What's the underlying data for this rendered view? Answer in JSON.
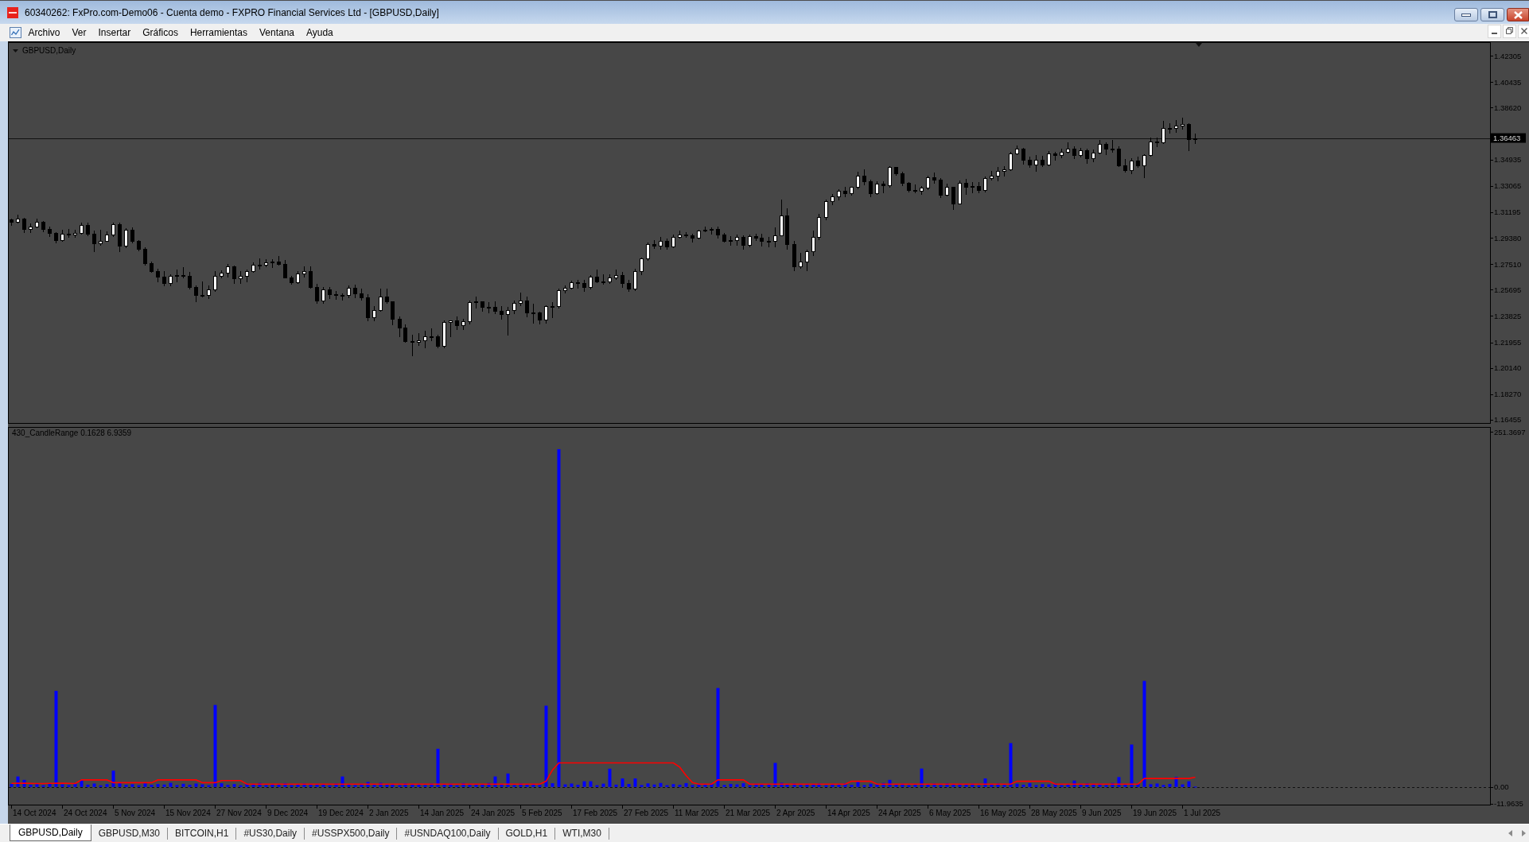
{
  "window": {
    "title": "60340262: FxPro.com-Demo06 - Cuenta demo - FXPRO Financial Services Ltd - [GBPUSD,Daily]"
  },
  "menu": {
    "items": [
      "Archivo",
      "Ver",
      "Insertar",
      "Gráficos",
      "Herramientas",
      "Ventana",
      "Ayuda"
    ]
  },
  "chart_window": {
    "chart_data": [
      {
        "type": "candlestick",
        "title": "GBPUSD,Daily",
        "tick_labels": "y",
        "ylim": [
          1.1617,
          1.4327
        ],
        "yticks": [
          1.42305,
          1.40435,
          {
            "value": 1.3862,
            "label": "1.38620"
          },
          1.34935,
          1.33065,
          1.31195,
          {
            "value": 1.2938,
            "label": "1.29380"
          },
          {
            "value": 1.2751,
            "label": "1.27510"
          },
          1.25695,
          1.23825,
          1.21955,
          {
            "value": 1.2014,
            "label": "1.20140"
          },
          {
            "value": 1.1827,
            "label": "1.18270"
          },
          1.16455
        ],
        "ref_lines": [
          {
            "axis": "y",
            "value": 1.36463,
            "label": "1.36463"
          }
        ],
        "ohlc": [
          [
            1.3067,
            1.3076,
            1.3031,
            1.3053
          ],
          [
            1.3053,
            1.3103,
            1.3048,
            1.3071
          ],
          [
            1.3071,
            1.308,
            1.298,
            1.2999
          ],
          [
            1.2999,
            1.304,
            1.2975,
            1.3017
          ],
          [
            1.3017,
            1.3071,
            1.301,
            1.3049
          ],
          [
            1.3049,
            1.3058,
            1.2985,
            1.2999
          ],
          [
            1.2999,
            1.3018,
            1.2949,
            1.297
          ],
          [
            1.297,
            1.298,
            1.2906,
            1.2922
          ],
          [
            1.2922,
            1.2996,
            1.2915,
            1.2969
          ],
          [
            1.2969,
            1.3002,
            1.2946,
            1.2959
          ],
          [
            1.2959,
            1.2996,
            1.2941,
            1.2973
          ],
          [
            1.2973,
            1.3044,
            1.2967,
            1.3028
          ],
          [
            1.3028,
            1.3044,
            1.2954,
            1.2967
          ],
          [
            1.2967,
            1.2989,
            1.2844,
            1.2897
          ],
          [
            1.2897,
            1.2993,
            1.2887,
            1.2917
          ],
          [
            1.2917,
            1.2984,
            1.2916,
            1.2962
          ],
          [
            1.2962,
            1.3048,
            1.2951,
            1.3036
          ],
          [
            1.3036,
            1.3047,
            1.2844,
            1.2882
          ],
          [
            1.2882,
            1.3008,
            1.287,
            1.2997
          ],
          [
            1.2997,
            1.301,
            1.2906,
            1.2915
          ],
          [
            1.2915,
            1.2922,
            1.285,
            1.2861
          ],
          [
            1.2861,
            1.2868,
            1.2745,
            1.2758
          ],
          [
            1.2758,
            1.277,
            1.2697,
            1.2701
          ],
          [
            1.2701,
            1.272,
            1.263,
            1.2664
          ],
          [
            1.2664,
            1.2702,
            1.2597,
            1.2616
          ],
          [
            1.2616,
            1.2676,
            1.2597,
            1.2667
          ],
          [
            1.2667,
            1.2713,
            1.2629,
            1.2673
          ],
          [
            1.2673,
            1.2728,
            1.2654,
            1.2668
          ],
          [
            1.2668,
            1.2695,
            1.2576,
            1.2588
          ],
          [
            1.2588,
            1.2599,
            1.2487,
            1.253
          ],
          [
            1.253,
            1.2628,
            1.252,
            1.2531
          ],
          [
            1.2531,
            1.2597,
            1.2508,
            1.2572
          ],
          [
            1.2572,
            1.27,
            1.256,
            1.2666
          ],
          [
            1.2666,
            1.2705,
            1.2656,
            1.2688
          ],
          [
            1.2688,
            1.2749,
            1.266,
            1.2735
          ],
          [
            1.2735,
            1.2741,
            1.2616,
            1.265
          ],
          [
            1.265,
            1.27,
            1.2615,
            1.2668
          ],
          [
            1.2668,
            1.2715,
            1.2626,
            1.2701
          ],
          [
            1.2701,
            1.2765,
            1.2695,
            1.2745
          ],
          [
            1.2745,
            1.279,
            1.2716,
            1.2744
          ],
          [
            1.2744,
            1.2787,
            1.2735,
            1.2761
          ],
          [
            1.2761,
            1.2783,
            1.273,
            1.2771
          ],
          [
            1.2771,
            1.2811,
            1.2744,
            1.275
          ],
          [
            1.275,
            1.278,
            1.2654,
            1.2658
          ],
          [
            1.2658,
            1.2669,
            1.2613,
            1.262
          ],
          [
            1.262,
            1.2703,
            1.2618,
            1.2686
          ],
          [
            1.2686,
            1.2733,
            1.2662,
            1.27
          ],
          [
            1.27,
            1.2735,
            1.2585,
            1.2587
          ],
          [
            1.2587,
            1.2609,
            1.2475,
            1.2492
          ],
          [
            1.2492,
            1.2586,
            1.2475,
            1.2571
          ],
          [
            1.2571,
            1.2587,
            1.2509,
            1.2535
          ],
          [
            1.2535,
            1.256,
            1.2503,
            1.253
          ],
          [
            1.253,
            1.2544,
            1.2497,
            1.253
          ],
          [
            1.253,
            1.26,
            1.2516,
            1.258
          ],
          [
            1.258,
            1.2607,
            1.2515,
            1.2545
          ],
          [
            1.2545,
            1.2576,
            1.2498,
            1.2515
          ],
          [
            1.2515,
            1.2537,
            1.2351,
            1.2376
          ],
          [
            1.2376,
            1.2453,
            1.2351,
            1.2422
          ],
          [
            1.2422,
            1.2575,
            1.242,
            1.2519
          ],
          [
            1.2519,
            1.2576,
            1.2474,
            1.2484
          ],
          [
            1.2484,
            1.2487,
            1.232,
            1.2363
          ],
          [
            1.2363,
            1.238,
            1.2239,
            1.2302
          ],
          [
            1.2302,
            1.2322,
            1.22,
            1.2205
          ],
          [
            1.2205,
            1.225,
            1.21,
            1.2201
          ],
          [
            1.2201,
            1.2259,
            1.2175,
            1.2208
          ],
          [
            1.2208,
            1.228,
            1.216,
            1.2239
          ],
          [
            1.2239,
            1.2292,
            1.221,
            1.2237
          ],
          [
            1.2237,
            1.2252,
            1.216,
            1.217
          ],
          [
            1.217,
            1.235,
            1.216,
            1.2342
          ],
          [
            1.2342,
            1.2353,
            1.2236,
            1.2352
          ],
          [
            1.2352,
            1.2378,
            1.229,
            1.2316
          ],
          [
            1.2316,
            1.2365,
            1.229,
            1.2344
          ],
          [
            1.2344,
            1.2493,
            1.2329,
            1.248
          ],
          [
            1.248,
            1.2523,
            1.244,
            1.2484
          ],
          [
            1.2484,
            1.2487,
            1.242,
            1.2446
          ],
          [
            1.2446,
            1.2479,
            1.241,
            1.2448
          ],
          [
            1.2448,
            1.2486,
            1.24,
            1.242
          ],
          [
            1.242,
            1.2451,
            1.2364,
            1.2394
          ],
          [
            1.2394,
            1.2445,
            1.2249,
            1.2422
          ],
          [
            1.2422,
            1.2494,
            1.24,
            1.2476
          ],
          [
            1.2476,
            1.255,
            1.2457,
            1.2494
          ],
          [
            1.2494,
            1.2522,
            1.238,
            1.2409
          ],
          [
            1.2409,
            1.247,
            1.2334,
            1.2405
          ],
          [
            1.2405,
            1.2415,
            1.2331,
            1.2358
          ],
          [
            1.2358,
            1.2457,
            1.2335,
            1.2451
          ],
          [
            1.2451,
            1.2478,
            1.2375,
            1.2454
          ],
          [
            1.2454,
            1.2576,
            1.2439,
            1.2564
          ],
          [
            1.2564,
            1.26,
            1.255,
            1.2582
          ],
          [
            1.2582,
            1.2632,
            1.2578,
            1.262
          ],
          [
            1.262,
            1.264,
            1.2585,
            1.2617
          ],
          [
            1.2617,
            1.264,
            1.256,
            1.259
          ],
          [
            1.259,
            1.2674,
            1.2577,
            1.2664
          ],
          [
            1.2664,
            1.2715,
            1.262,
            1.2629
          ],
          [
            1.2629,
            1.2678,
            1.261,
            1.2627
          ],
          [
            1.2627,
            1.268,
            1.2616,
            1.2657
          ],
          [
            1.2657,
            1.2715,
            1.2647,
            1.2671
          ],
          [
            1.2671,
            1.2693,
            1.259,
            1.2617
          ],
          [
            1.2617,
            1.2637,
            1.256,
            1.2575
          ],
          [
            1.2575,
            1.2718,
            1.2566,
            1.2703
          ],
          [
            1.2703,
            1.2798,
            1.2676,
            1.2794
          ],
          [
            1.2794,
            1.2906,
            1.2778,
            1.2895
          ],
          [
            1.2895,
            1.2921,
            1.2862,
            1.2883
          ],
          [
            1.2883,
            1.2946,
            1.2861,
            1.2918
          ],
          [
            1.2918,
            1.2932,
            1.286,
            1.2878
          ],
          [
            1.2878,
            1.296,
            1.2873,
            1.2944
          ],
          [
            1.2944,
            1.2989,
            1.294,
            1.2963
          ],
          [
            1.2963,
            1.298,
            1.2943,
            1.2953
          ],
          [
            1.2953,
            1.2969,
            1.2908,
            1.2936
          ],
          [
            1.2936,
            1.2997,
            1.293,
            1.2987
          ],
          [
            1.2987,
            1.3015,
            1.2981,
            1.2997
          ],
          [
            1.2997,
            1.3014,
            1.2964,
            1.3
          ],
          [
            1.3,
            1.3015,
            1.294,
            1.2959
          ],
          [
            1.2959,
            1.2971,
            1.291,
            1.2918
          ],
          [
            1.2918,
            1.2951,
            1.2886,
            1.2921
          ],
          [
            1.2921,
            1.296,
            1.289,
            1.2946
          ],
          [
            1.2946,
            1.2957,
            1.2861,
            1.2888
          ],
          [
            1.2888,
            1.296,
            1.2874,
            1.2947
          ],
          [
            1.2947,
            1.2967,
            1.292,
            1.294
          ],
          [
            1.294,
            1.2964,
            1.2879,
            1.2918
          ],
          [
            1.2918,
            1.2943,
            1.2876,
            1.2916
          ],
          [
            1.2916,
            1.301,
            1.2877,
            1.2957
          ],
          [
            1.2957,
            1.3207,
            1.2955,
            1.3097
          ],
          [
            1.3097,
            1.3148,
            1.286,
            1.2895
          ],
          [
            1.2895,
            1.2915,
            1.2708,
            1.2736
          ],
          [
            1.2736,
            1.283,
            1.2725,
            1.2766
          ],
          [
            1.2766,
            1.2855,
            1.2707,
            1.284
          ],
          [
            1.284,
            1.299,
            1.2812,
            1.2941
          ],
          [
            1.2941,
            1.3106,
            1.2926,
            1.3086
          ],
          [
            1.3086,
            1.3208,
            1.307,
            1.3196
          ],
          [
            1.3196,
            1.3251,
            1.3174,
            1.3234
          ],
          [
            1.3234,
            1.3283,
            1.3207,
            1.3269
          ],
          [
            1.3269,
            1.3297,
            1.3233,
            1.3254
          ],
          [
            1.3254,
            1.3302,
            1.3243,
            1.3298
          ],
          [
            1.3298,
            1.3405,
            1.329,
            1.3377
          ],
          [
            1.3377,
            1.3423,
            1.3318,
            1.3341
          ],
          [
            1.3341,
            1.3351,
            1.3233,
            1.3253
          ],
          [
            1.3253,
            1.3337,
            1.325,
            1.3322
          ],
          [
            1.3322,
            1.3341,
            1.3262,
            1.3311
          ],
          [
            1.3311,
            1.3445,
            1.3302,
            1.344
          ],
          [
            1.344,
            1.3443,
            1.3382,
            1.3396
          ],
          [
            1.3396,
            1.3405,
            1.331,
            1.3328
          ],
          [
            1.3328,
            1.3336,
            1.3263,
            1.3279
          ],
          [
            1.3279,
            1.3317,
            1.3259,
            1.3269
          ],
          [
            1.3269,
            1.3304,
            1.325,
            1.3295
          ],
          [
            1.3295,
            1.338,
            1.328,
            1.3366
          ],
          [
            1.3366,
            1.3402,
            1.3326,
            1.335
          ],
          [
            1.335,
            1.3362,
            1.3228,
            1.3245
          ],
          [
            1.3245,
            1.332,
            1.324,
            1.33
          ],
          [
            1.33,
            1.33,
            1.314,
            1.3183
          ],
          [
            1.3183,
            1.3343,
            1.318,
            1.3328
          ],
          [
            1.3328,
            1.3358,
            1.325,
            1.3302
          ],
          [
            1.3302,
            1.3335,
            1.326,
            1.3305
          ],
          [
            1.3305,
            1.3335,
            1.326,
            1.3278
          ],
          [
            1.3278,
            1.3373,
            1.3265,
            1.3359
          ],
          [
            1.3359,
            1.3413,
            1.335,
            1.3378
          ],
          [
            1.3378,
            1.3439,
            1.3345,
            1.3414
          ],
          [
            1.3414,
            1.3444,
            1.338,
            1.3424
          ],
          [
            1.3424,
            1.3546,
            1.3417,
            1.3535
          ],
          [
            1.3535,
            1.3593,
            1.353,
            1.3568
          ],
          [
            1.3568,
            1.3575,
            1.3464,
            1.3491
          ],
          [
            1.3491,
            1.3515,
            1.344,
            1.3459
          ],
          [
            1.3459,
            1.3527,
            1.3415,
            1.3494
          ],
          [
            1.3494,
            1.352,
            1.3446,
            1.3459
          ],
          [
            1.3459,
            1.3555,
            1.345,
            1.3535
          ],
          [
            1.3535,
            1.355,
            1.3492,
            1.3528
          ],
          [
            1.3528,
            1.357,
            1.351,
            1.3549
          ],
          [
            1.3549,
            1.3616,
            1.354,
            1.3571
          ],
          [
            1.3571,
            1.359,
            1.35,
            1.3528
          ],
          [
            1.3528,
            1.3575,
            1.3515,
            1.356
          ],
          [
            1.356,
            1.357,
            1.347,
            1.35
          ],
          [
            1.35,
            1.3564,
            1.348,
            1.3543
          ],
          [
            1.3543,
            1.3632,
            1.3535,
            1.3606
          ],
          [
            1.3606,
            1.3615,
            1.3532,
            1.3571
          ],
          [
            1.3571,
            1.3632,
            1.355,
            1.3572
          ],
          [
            1.3572,
            1.359,
            1.3445,
            1.3451
          ],
          [
            1.3451,
            1.3495,
            1.3405,
            1.3419
          ],
          [
            1.3419,
            1.35,
            1.3395,
            1.3485
          ],
          [
            1.3485,
            1.3515,
            1.344,
            1.345
          ],
          [
            1.345,
            1.353,
            1.337,
            1.3525
          ],
          [
            1.3525,
            1.365,
            1.352,
            1.3619
          ],
          [
            1.3619,
            1.3652,
            1.359,
            1.3615
          ],
          [
            1.3615,
            1.377,
            1.361,
            1.372
          ],
          [
            1.372,
            1.3749,
            1.3685,
            1.3717
          ],
          [
            1.3717,
            1.3771,
            1.369,
            1.3732
          ],
          [
            1.3732,
            1.3788,
            1.371,
            1.3745
          ],
          [
            1.3745,
            1.375,
            1.356,
            1.3639
          ],
          [
            1.3639,
            1.368,
            1.361,
            1.3646
          ],
          null,
          null,
          null,
          null,
          null,
          null,
          null,
          null,
          null,
          null,
          null,
          null,
          null,
          null,
          null,
          null,
          null,
          null,
          null,
          null,
          null,
          null,
          null,
          null,
          null,
          null,
          null,
          null,
          null,
          null,
          null,
          null,
          null,
          null,
          null,
          null,
          null,
          null,
          null,
          null,
          null,
          null,
          null,
          null,
          null,
          null
        ]
      },
      {
        "type": "bar",
        "title": "430_CandleRange 0.1628 6.9359",
        "tick_labels": "y",
        "ylim": [
          -13.09,
          254.75
        ],
        "yticks": [
          251.3697,
          {
            "value": 0,
            "label": "0.00"
          },
          -11.9635
        ],
        "ref_lines": [
          {
            "axis": "y",
            "value": 0,
            "line_style": "dashed"
          }
        ],
        "series": [
          {
            "type": "bar",
            "color": "#0000ff",
            "values": [
              2.1,
              7.4,
              5,
              1.5,
              2,
              1.2,
              2.5,
              68,
              1.8,
              1.3,
              2.2,
              5,
              1.6,
              2.4,
              1.1,
              2,
              11.5,
              2.8,
              1.5,
              1.9,
              1.2,
              2.6,
              1.4,
              2,
              1.7,
              2.9,
              1.3,
              2.2,
              1.5,
              2.4,
              1.8,
              1.2,
              58,
              2.6,
              1.4,
              2,
              1.1,
              2.3,
              1.6,
              2.8,
              1.3,
              2.1,
              1.5,
              2.7,
              1.2,
              1.9,
              2.4,
              1.4,
              2.2,
              1.6,
              1.1,
              2.5,
              7.4,
              1.8,
              1.3,
              2.2,
              3.5,
              1.4,
              2.9,
              1.7,
              2.1,
              1.2,
              2.6,
              1.5,
              2,
              1.3,
              2.4,
              27,
              1.8,
              2.3,
              1.1,
              2.7,
              1.4,
              2,
              1.6,
              2.8,
              7.4,
              1.9,
              9.5,
              1.3,
              2.5,
              1.7,
              2.2,
              1.4,
              57.5,
              2.6,
              239,
              1.8,
              2.4,
              1.5,
              4,
              4,
              1.2,
              2.3,
              12.9,
              1.6,
              6,
              2.1,
              6,
              1.3,
              2.5,
              1.7,
              2.8,
              1.2,
              2,
              1.5,
              2.7,
              1.3,
              2.2,
              1.6,
              2.4,
              70,
              1.4,
              2.1,
              1.8,
              2.6,
              1.2,
              2.3,
              1.5,
              2,
              17,
              2.9,
              1.6,
              2.4,
              1.3,
              2.2,
              1.7,
              2.5,
              1.2,
              2.1,
              1.8,
              2.6,
              1.4,
              4,
              1.3,
              2.2,
              1.6,
              2.8,
              5,
              1.5,
              2.3,
              1.2,
              2,
              13,
              1.7,
              2.4,
              1.3,
              2.6,
              1.5,
              2.1,
              1.8,
              2.3,
              1.1,
              6,
              1.9,
              2.5,
              1.4,
              31,
              2.2,
              1.6,
              2.7,
              1.3,
              2,
              1.8,
              2.4,
              1.2,
              2.1,
              4.5,
              1.5,
              2.6,
              1.7,
              2.2,
              1.3,
              2.8,
              7,
              1.6,
              30,
              2.3,
              75,
              1.9,
              2.4,
              1.4,
              2.1,
              7,
              1.8,
              4,
              0.2,
              null,
              null,
              null,
              null,
              null,
              null,
              null,
              null,
              null,
              null,
              null,
              null,
              null,
              null,
              null,
              null,
              null,
              null,
              null,
              null,
              null,
              null,
              null,
              null,
              null,
              null,
              null,
              null,
              null,
              null,
              null,
              null,
              null,
              null,
              null,
              null,
              null,
              null,
              null,
              null,
              null,
              null,
              null,
              null,
              null,
              null
            ]
          },
          {
            "type": "line",
            "color": "#ff0000",
            "values": [
              2.5,
              2.6,
              2.6,
              2.5,
              2.4,
              2.4,
              2.5,
              2.6,
              2.6,
              2.5,
              2.4,
              5,
              5,
              5,
              5,
              5,
              3,
              3,
              3,
              3,
              3,
              3,
              3,
              5,
              5,
              5,
              5,
              5,
              5,
              5,
              3,
              3,
              3,
              4.5,
              4.5,
              4.5,
              4.5,
              2,
              2,
              2,
              2,
              2,
              2,
              2,
              2,
              2,
              2,
              2,
              2,
              2,
              2,
              2,
              2,
              2,
              2,
              2,
              2,
              2,
              2,
              2,
              2,
              2,
              2,
              2,
              2,
              2,
              2,
              2,
              2,
              2,
              2,
              2,
              2,
              2,
              2,
              2,
              2,
              2,
              2,
              2,
              2,
              2,
              2,
              2,
              4,
              12,
              17,
              17,
              17,
              17,
              17,
              17,
              17,
              17,
              17,
              17,
              17,
              17,
              17,
              17,
              17,
              17,
              17,
              17,
              17,
              14,
              8,
              3,
              2,
              2,
              2,
              5,
              5,
              5,
              5,
              5,
              2,
              2,
              2,
              2,
              2,
              2,
              2,
              2,
              2,
              2,
              2,
              2,
              2,
              2,
              2,
              2,
              4,
              4,
              4,
              4,
              2,
              2,
              2,
              2,
              2,
              2,
              2,
              2,
              2,
              2,
              2,
              2,
              2,
              2,
              2,
              2,
              2,
              2,
              2,
              2,
              2,
              2,
              4,
              4,
              4,
              4,
              4,
              4,
              2,
              2,
              2,
              2,
              2,
              2,
              2,
              2,
              2,
              2,
              2,
              2,
              2,
              2,
              6,
              6,
              6,
              6,
              6,
              6,
              6,
              6,
              6.9,
              null,
              null,
              null,
              null,
              null,
              null,
              null,
              null,
              null,
              null,
              null,
              null,
              null,
              null,
              null,
              null,
              null,
              null,
              null,
              null,
              null,
              null,
              null,
              null,
              null,
              null,
              null,
              null,
              null,
              null,
              null,
              null,
              null,
              null,
              null,
              null,
              null,
              null,
              null,
              null,
              null,
              null,
              null,
              null,
              null,
              null
            ]
          }
        ]
      }
    ],
    "time_scale": {
      "labels": [
        "14 Oct 2024",
        "24 Oct 2024",
        "5 Nov 2024",
        "15 Nov 2024",
        "27 Nov 2024",
        "9 Dec 2024",
        "19 Dec 2024",
        "2 Jan 2025",
        "14 Jan 2025",
        "24 Jan 2025",
        "5 Feb 2025",
        "17 Feb 2025",
        "27 Feb 2025",
        "11 Mar 2025",
        "21 Mar 2025",
        "2 Apr 2025",
        "14 Apr 2025",
        "24 Apr 2025",
        "6 May 2025",
        "16 May 2025",
        "28 May 2025",
        "9 Jun 2025",
        "19 Jun 2025",
        "1 Jul 2025"
      ]
    }
  },
  "tabs": [
    {
      "label": "GBPUSD,Daily",
      "selected": true
    },
    {
      "label": "GBPUSD,M30",
      "selected": false
    },
    {
      "label": "BITCOIN,H1",
      "selected": false
    },
    {
      "label": "#US30,Daily",
      "selected": false
    },
    {
      "label": "#USSPX500,Daily",
      "selected": false
    },
    {
      "label": "#USNDAQ100,Daily",
      "selected": false
    },
    {
      "label": "GOLD,H1",
      "selected": false
    },
    {
      "label": "WTI,M30",
      "selected": false
    }
  ]
}
